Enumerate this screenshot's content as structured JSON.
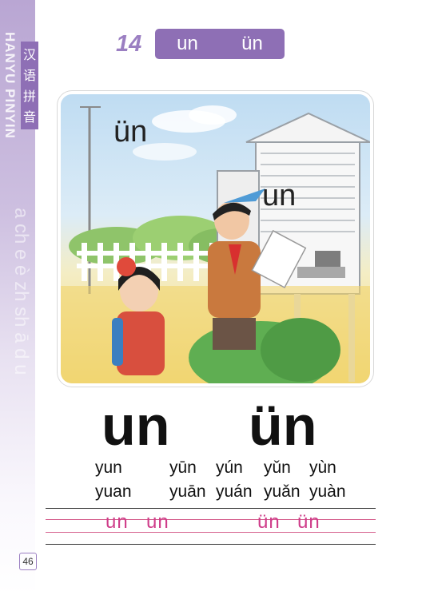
{
  "sidebar": {
    "label": "汉语拼音",
    "vertical_text": "HANYU PINYIN",
    "faint_letters": "a ch e è zh sh ā d u"
  },
  "header": {
    "lesson_number": "14",
    "title_finals": [
      "un",
      "ün"
    ]
  },
  "illustration": {
    "label_1": "ün",
    "label_2": "un"
  },
  "main": {
    "finals": [
      "un",
      "ün"
    ],
    "pinyin_rows": [
      [
        "yun",
        "yūn",
        "yún",
        "yǔn",
        "yùn"
      ],
      [
        "yuan",
        "yuān",
        "yuán",
        "yuǎn",
        "yuàn"
      ]
    ],
    "tracing": [
      "un",
      "un",
      "ün",
      "ün"
    ]
  },
  "footer": {
    "page_number": "46"
  },
  "colors": {
    "accent_purple": "#8e6fb5",
    "tracing_pink": "#cf3d8a"
  }
}
